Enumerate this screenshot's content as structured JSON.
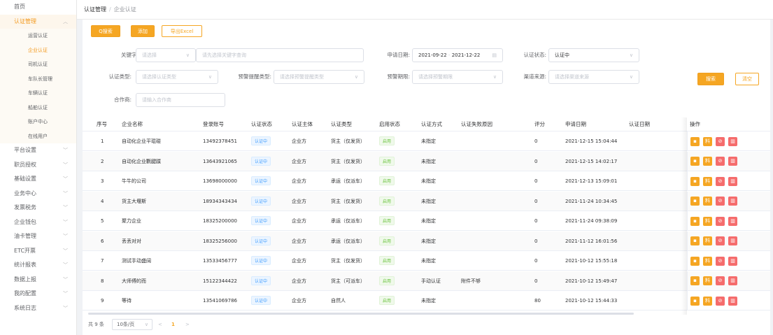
{
  "sidebar": {
    "home": "首页",
    "cert_mgmt": "认证管理",
    "cert_sub": [
      "运营认证",
      "企业认证",
      "司机认证",
      "车队长管理",
      "车辆认证",
      "船舶认证",
      "账户中心",
      "在线用户"
    ],
    "items": [
      "平台设置",
      "职员授权",
      "基础设置",
      "业务中心",
      "发票税务",
      "企业钱包",
      "油卡管理",
      "ETC开票",
      "统计报表",
      "数据上报",
      "我的配置",
      "系统日志"
    ],
    "colors": {
      "active": "#f39a1f"
    }
  },
  "breadcrumb": {
    "root": "认证管理",
    "sep": "/",
    "current": "企业认证"
  },
  "toolbar": {
    "search": "Q搜索",
    "add": "添加",
    "export": "导出Excel"
  },
  "filters": {
    "keyword_label": "关键字:",
    "keyword_select": "请选择",
    "keyword_input_placeholder": "请先选择关键字查询",
    "apply_date_label": "申请日期:",
    "apply_date_start": "2021-09-22",
    "apply_date_sep": "-",
    "apply_date_end": "2021-12-22",
    "cert_status_label": "认证状态:",
    "cert_status_value": "认证中",
    "cert_type_label": "认证类型:",
    "cert_type_placeholder": "请选择认证类型",
    "warn_type_label": "预警提醒类型:",
    "warn_type_placeholder": "请选择预警提醒类型",
    "warn_period_label": "预警期限:",
    "warn_period_placeholder": "请选择预警期限",
    "channel_label": "渠道来源:",
    "channel_placeholder": "请选择渠道来源",
    "partner_label": "合作商:",
    "partner_placeholder": "请输入合作商",
    "search_btn": "搜索",
    "clear_btn": "清空"
  },
  "table": {
    "columns": [
      "序号",
      "企业名称",
      "登录账号",
      "认证状态",
      "认证主体",
      "认证类型",
      "启用状态",
      "认证方式",
      "认证失败原因",
      "评分",
      "申请日期",
      "认证日期",
      "操作"
    ],
    "rows": [
      {
        "no": "1",
        "name": "自动化企业平琨碰",
        "account": "13492378451",
        "status": "认证中",
        "subject": "企业方",
        "type": "货主（仅发货）",
        "enabled": "启用",
        "method": "未指定",
        "reason": "",
        "score": "0",
        "apply": "2021-12-15 15:04:44",
        "cert": ""
      },
      {
        "no": "2",
        "name": "自动化企业氍腱蹼",
        "account": "13643921065",
        "status": "认证中",
        "subject": "企业方",
        "type": "货主（仅发货）",
        "enabled": "启用",
        "method": "未指定",
        "reason": "",
        "score": "0",
        "apply": "2021-12-15 14:02:17",
        "cert": ""
      },
      {
        "no": "3",
        "name": "牛牛的公司",
        "account": "13698000000",
        "status": "认证中",
        "subject": "企业方",
        "type": "承运（仅派车）",
        "enabled": "启用",
        "method": "未指定",
        "reason": "",
        "score": "0",
        "apply": "2021-12-13 15:09:01",
        "cert": ""
      },
      {
        "no": "4",
        "name": "货主大堰斯",
        "account": "18934343434",
        "status": "认证中",
        "subject": "企业方",
        "type": "货主（仅发货）",
        "enabled": "启用",
        "method": "未指定",
        "reason": "",
        "score": "0",
        "apply": "2021-11-24 10:34:45",
        "cert": ""
      },
      {
        "no": "5",
        "name": "聚力企业",
        "account": "18325200000",
        "status": "认证中",
        "subject": "企业方",
        "type": "承运（仅派车）",
        "enabled": "启用",
        "method": "未指定",
        "reason": "",
        "score": "0",
        "apply": "2021-11-24 09:38:09",
        "cert": ""
      },
      {
        "no": "6",
        "name": "丢丢对对",
        "account": "18325256000",
        "status": "认证中",
        "subject": "企业方",
        "type": "承运（仅派车）",
        "enabled": "启用",
        "method": "未指定",
        "reason": "",
        "score": "0",
        "apply": "2021-11-12 16:01:56",
        "cert": ""
      },
      {
        "no": "7",
        "name": "测试手动盛阔",
        "account": "13533456777",
        "status": "认证中",
        "subject": "企业方",
        "type": "货主（仅发货）",
        "enabled": "启用",
        "method": "未指定",
        "reason": "",
        "score": "0",
        "apply": "2021-10-12 15:55:18",
        "cert": ""
      },
      {
        "no": "8",
        "name": "大师傅的而",
        "account": "15122344422",
        "status": "认证中",
        "subject": "企业方",
        "type": "货主（可派车）",
        "enabled": "启用",
        "method": "手动认证",
        "reason": "附件不够",
        "score": "0",
        "apply": "2021-10-12 15:49:47",
        "cert": ""
      },
      {
        "no": "9",
        "name": "等待",
        "account": "13541069786",
        "status": "认证中",
        "subject": "企业方",
        "type": "自然人",
        "enabled": "启用",
        "method": "未指定",
        "reason": "",
        "score": "80",
        "apply": "2021-10-12 15:44:33",
        "cert": ""
      }
    ],
    "op_icons": [
      "view-icon",
      "edit-icon",
      "disable-icon",
      "delete-icon"
    ],
    "op_glyphs": [
      "▪",
      "料",
      "⊘",
      "▥"
    ]
  },
  "pagination": {
    "total": "共 9 条",
    "page_size": "10条/页",
    "prev": "<",
    "page": "1",
    "next": ">"
  },
  "colors": {
    "accent": "#f5a623",
    "danger": "#f56c6c",
    "info": "#409eff",
    "success": "#67c23a"
  }
}
